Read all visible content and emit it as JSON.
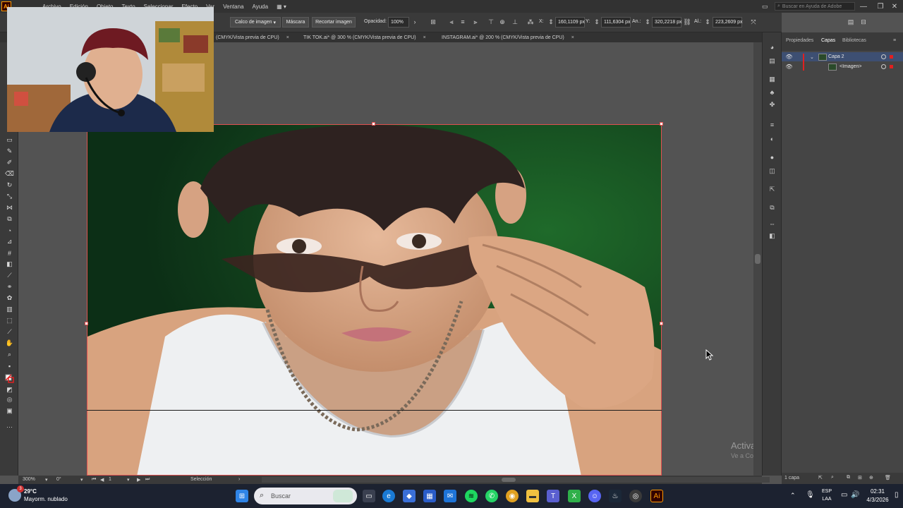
{
  "app": {
    "logo_text": "Ai",
    "menus": [
      "Archivo",
      "Edición",
      "Objeto",
      "Texto",
      "Seleccionar",
      "Efecto",
      "Ver",
      "Ventana",
      "Ayuda"
    ],
    "search_placeholder": "Buscar en Ayuda de Adobe"
  },
  "controlbar": {
    "trace_button": "Calco de imagen",
    "mask_button": "Máscara",
    "crop_button": "Recortar imagen",
    "opacity_label": "Opacidad:",
    "opacity_value": "100%",
    "x_label": "X:",
    "x_value": "160,1109 px",
    "y_label": "Y:",
    "y_value": "111,6304 px",
    "width_label": "An.:",
    "width_value": "320,2218 px",
    "height_label": "Al.:",
    "height_value": "223,2609 px"
  },
  "tabs": [
    {
      "label": "(CMYK/Vista previa de CPU)"
    },
    {
      "label": "TIK TOK.ai* @ 300 % (CMYK/Vista previa de CPU)"
    },
    {
      "label": "INSTAGRAM.ai* @ 200 % (CMYK/Vista previa de CPU)"
    }
  ],
  "statusbar": {
    "zoom": "300%",
    "rotation": "0°",
    "artboard_number": "1",
    "tool_name": "Selección"
  },
  "panel": {
    "tabs": [
      "Propiedades",
      "Capas",
      "Bibliotecas"
    ],
    "active_tab": "Capas",
    "layers": [
      {
        "name": "Capa 2",
        "selected": true
      },
      {
        "name": "<Imagen>",
        "selected": false
      }
    ],
    "footer_count": "1 capa"
  },
  "watermark": {
    "title": "Activar Windows",
    "subtitle": "Ve a Configuración para activar Windows."
  },
  "taskbar": {
    "weather_temp": "29°C",
    "weather_desc": "Mayorm. nublado",
    "weather_badge": "3",
    "search_label": "Buscar",
    "lang_line1": "ESP",
    "lang_line2": "LAA",
    "time": "02:31",
    "date": "4/3/2026"
  }
}
